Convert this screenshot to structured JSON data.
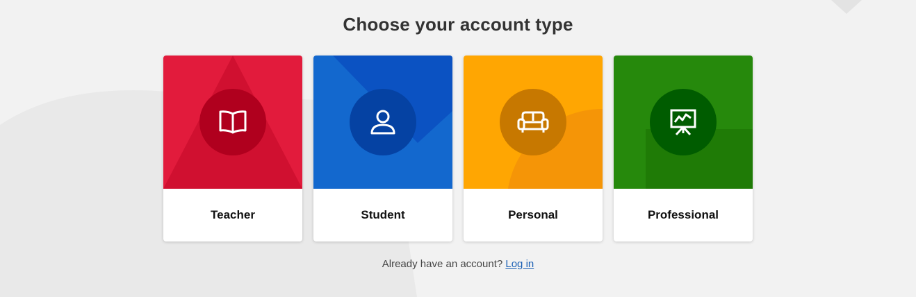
{
  "heading": "Choose your account type",
  "cards": [
    {
      "label": "Teacher",
      "icon": "book-icon",
      "color": "#e21b3c",
      "circle_color": "#b0001e"
    },
    {
      "label": "Student",
      "icon": "user-icon",
      "color": "#1368ce",
      "circle_color": "#0542a3"
    },
    {
      "label": "Personal",
      "icon": "sofa-icon",
      "color": "#ffa602",
      "circle_color": "#c77800"
    },
    {
      "label": "Professional",
      "icon": "presentation-icon",
      "color": "#26890c",
      "circle_color": "#005c00"
    }
  ],
  "login": {
    "prompt": "Already have an account?",
    "link_label": "Log in"
  }
}
